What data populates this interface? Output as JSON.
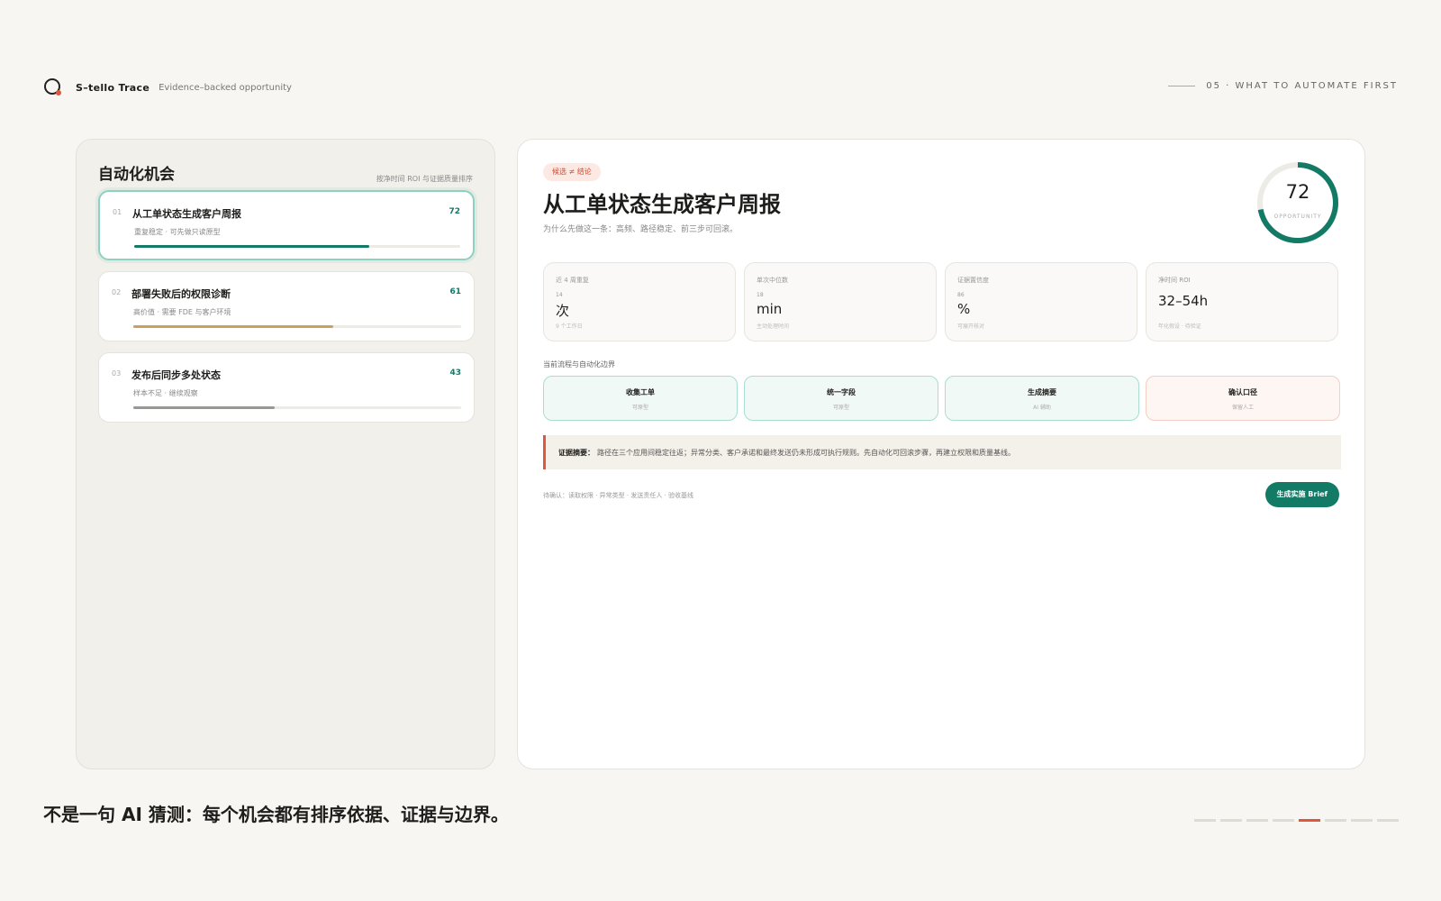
{
  "header": {
    "brand_name": "S–tello Trace",
    "brand_tagline": "Evidence–backed opportunity",
    "section": "05 · WHAT TO AUTOMATE FIRST"
  },
  "left_panel": {
    "title": "自动化机会",
    "sort_note": "按净时间 ROI 与证据质量排序",
    "items": [
      {
        "index": "01",
        "name": "从工单状态生成客户周报",
        "score": "72",
        "subtitle": "重复稳定 · 可先做只读原型",
        "progress": 0.72,
        "color": "#137a66"
      },
      {
        "index": "02",
        "name": "部署失败后的权限诊断",
        "score": "61",
        "subtitle": "高价值 · 需要 FDE 与客户环境",
        "progress": 0.61,
        "color": "#c9a25a"
      },
      {
        "index": "03",
        "name": "发布后同步多处状态",
        "score": "43",
        "subtitle": "样本不足 · 继续观察",
        "progress": 0.43,
        "color": "#9a9893"
      }
    ]
  },
  "detail": {
    "tag": "候选 ≠ 结论",
    "title": "从工单状态生成客户周报",
    "subtitle": "为什么先做这一条：高频、路径稳定、前三步可回滚。",
    "score": "72",
    "score_label": "OPPORTUNITY",
    "score_fraction": 0.72,
    "metrics": [
      {
        "label": "近 4 周重复",
        "small": "14",
        "value": "次",
        "note": "9 个工作日"
      },
      {
        "label": "单次中位数",
        "small": "18",
        "value": "min",
        "note": "主动处理时间"
      },
      {
        "label": "证据置信度",
        "small": "86",
        "value": "%",
        "note": "可展开核对"
      },
      {
        "label": "净时间 ROI",
        "small": "",
        "value": "32–54h",
        "note": "年化假设 · 待验证"
      }
    ],
    "flow_label": "当前流程与自动化边界",
    "flow_steps": [
      {
        "name": "收集工单",
        "note": "可原型",
        "warn": false
      },
      {
        "name": "统一字段",
        "note": "可原型",
        "warn": false
      },
      {
        "name": "生成摘要",
        "note": "AI 辅助",
        "warn": false
      },
      {
        "name": "确认口径",
        "note": "保留人工",
        "warn": true
      }
    ],
    "evidence_key": "证据摘要：",
    "evidence_text": "路径在三个应用间稳定往返；异常分类、客户承诺和最终发送仍未形成可执行规则。先自动化可回滚步骤，再建立权限和质量基线。",
    "pending": "待确认：读取权限 · 异常类型 · 发送责任人 · 验收基线",
    "cta_label": "生成实施 Brief"
  },
  "caption": "不是一句 AI 猜测：每个机会都有排序依据、证据与边界。",
  "pager": {
    "total": 8,
    "current": 5
  }
}
